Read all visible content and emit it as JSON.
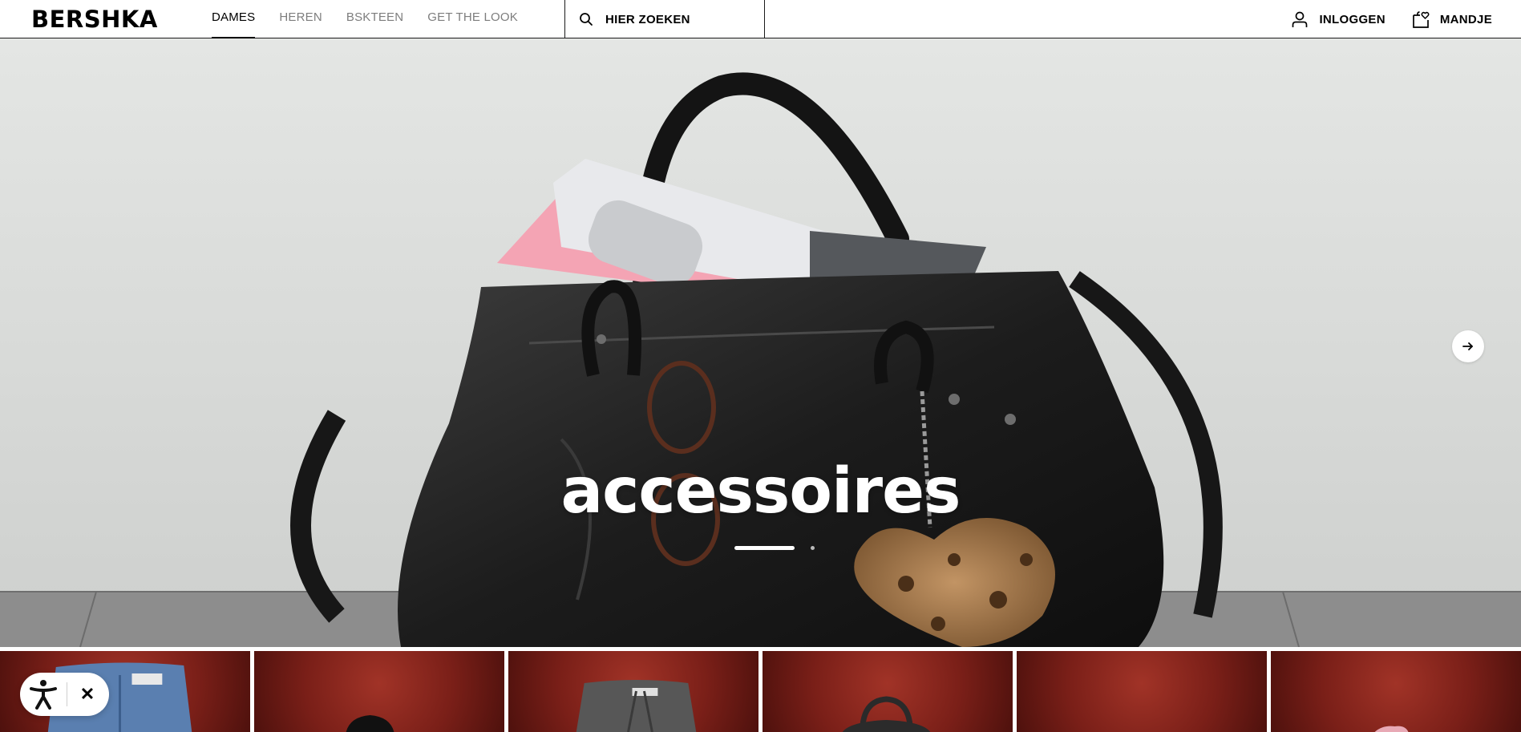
{
  "brand": "BERSHKA",
  "nav": {
    "items": [
      {
        "label": "DAMES",
        "active": true
      },
      {
        "label": "HEREN",
        "active": false
      },
      {
        "label": "BSKTEEN",
        "active": false
      },
      {
        "label": "GET THE LOOK",
        "active": false
      }
    ]
  },
  "search": {
    "label": "HIER ZOEKEN",
    "icon": "search-icon"
  },
  "account": {
    "login_label": "INLOGGEN",
    "login_icon": "user-icon",
    "cart_label": "MANDJE",
    "cart_icon": "shopping-bag-heart-icon"
  },
  "hero": {
    "title": "accessoires",
    "slide_index": 1,
    "slide_count": 2,
    "next_icon": "arrow-right-icon"
  },
  "tiles": {
    "count": 6,
    "background_color": "#8a251c",
    "items": [
      {
        "name": "jeans-tile"
      },
      {
        "name": "sunglasses-tile"
      },
      {
        "name": "trousers-tile"
      },
      {
        "name": "bag-tile"
      },
      {
        "name": "blank-tile"
      },
      {
        "name": "shoes-tile"
      }
    ]
  },
  "accessibility": {
    "icon": "accessibility-person-icon",
    "close_label": "✕"
  }
}
